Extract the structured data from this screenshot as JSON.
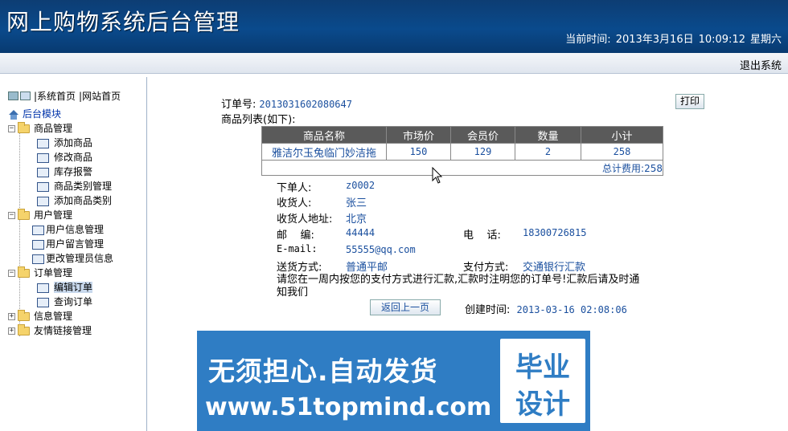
{
  "header": {
    "title": "网上购物系统后台管理",
    "time_label": "当前时间:",
    "time_value": "2013年3月16日",
    "clock": "10:09:12",
    "weekday": "星期六",
    "logout": "退出系统"
  },
  "sidebar": {
    "links": [
      "|系统首页",
      "|网站首页"
    ],
    "root": "后台模块",
    "groups": [
      {
        "label": "商品管理",
        "items": [
          "添加商品",
          "修改商品",
          "库存报警",
          "商品类别管理",
          "添加商品类别"
        ]
      },
      {
        "label": "用户管理",
        "items": [
          "用户信息管理",
          "用户留言管理",
          "更改管理员信息"
        ]
      },
      {
        "label": "订单管理",
        "items": [
          "编辑订单",
          "查询订单"
        ]
      },
      {
        "label": "信息管理",
        "items": []
      },
      {
        "label": "友情链接管理",
        "items": []
      }
    ],
    "active_item": "编辑订单"
  },
  "order": {
    "order_no_label": "订单号:",
    "order_no": "2013031602080647",
    "print_button": "打印",
    "goods_list_label": "商品列表(如下):",
    "table": {
      "headers": [
        "商品名称",
        "市场价",
        "会员价",
        "数量",
        "小计"
      ],
      "rows": [
        [
          "雅洁尔玉兔临门妙洁拖",
          "150",
          "129",
          "2",
          "258"
        ]
      ],
      "total": "总计费用:258"
    },
    "buyer_label": "下单人:",
    "buyer": "z0002",
    "receiver_label": "收货人:",
    "receiver": "张三",
    "address_label": "收货人地址:",
    "address": "北京",
    "zip_label": "邮    编:",
    "zip": "44444",
    "phone_label": "电    话:",
    "phone": "18300726815",
    "email_label": "E-mail:",
    "email": "55555@qq.com",
    "delivery_label": "送货方式:",
    "delivery": "普通平邮",
    "payment_label": "支付方式:",
    "payment": "交通银行汇款",
    "notice": "请您在一周内按您的支付方式进行汇款,汇款时注明您的订单号!汇款后请及时通知我们",
    "back_button": "返回上一页",
    "created_label": "创建时间:",
    "created": "2013-03-16 02:08:06"
  },
  "banner": {
    "line1": "无须担心.自动发货",
    "line2": "www.51topmind.com",
    "badge_top": "毕业",
    "badge_bottom": "设计"
  }
}
